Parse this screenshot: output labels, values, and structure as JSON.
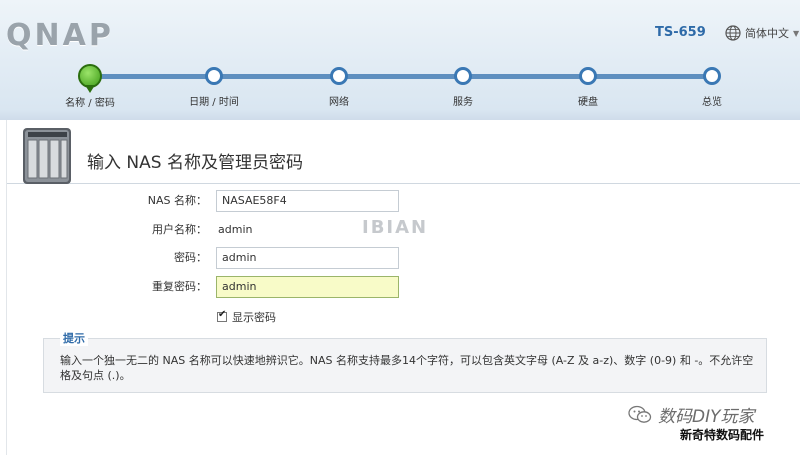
{
  "header": {
    "logo": "QNAP",
    "model": "TS-659",
    "language": "简体中文"
  },
  "steps": [
    {
      "label": "名称 / 密码",
      "active": true
    },
    {
      "label": "日期 / 时间",
      "active": false
    },
    {
      "label": "网络",
      "active": false
    },
    {
      "label": "服务",
      "active": false
    },
    {
      "label": "硬盘",
      "active": false
    },
    {
      "label": "总览",
      "active": false
    }
  ],
  "panel": {
    "title": "输入 NAS 名称及管理员密码"
  },
  "form": {
    "nas_name_label": "NAS 名称：",
    "nas_name_value": "NASAE58F4",
    "username_label": "用户名称：",
    "username_value": "admin",
    "password_label": "密码：",
    "password_value": "admin",
    "confirm_label": "重复密码：",
    "confirm_value": "admin",
    "show_password_label": "显示密码",
    "show_password_checked": true
  },
  "watermark": "IBIAN",
  "tip": {
    "title": "提示",
    "text": "输入一个独一无二的 NAS 名称可以快速地辨识它。NAS 名称支持最多14个字符，可以包含英文字母 (A-Z 及 a-z)、数字 (0-9) 和 -。不允许空格及句点 (.)。"
  },
  "footer": {
    "brand": "数码DIY玩家",
    "subtitle": "新奇特数码配件"
  },
  "colors": {
    "accent": "#2e6aa8",
    "track": "#5e8fbf",
    "active_step": "#3d9b16",
    "highlight_input": "#f8fbc8"
  }
}
